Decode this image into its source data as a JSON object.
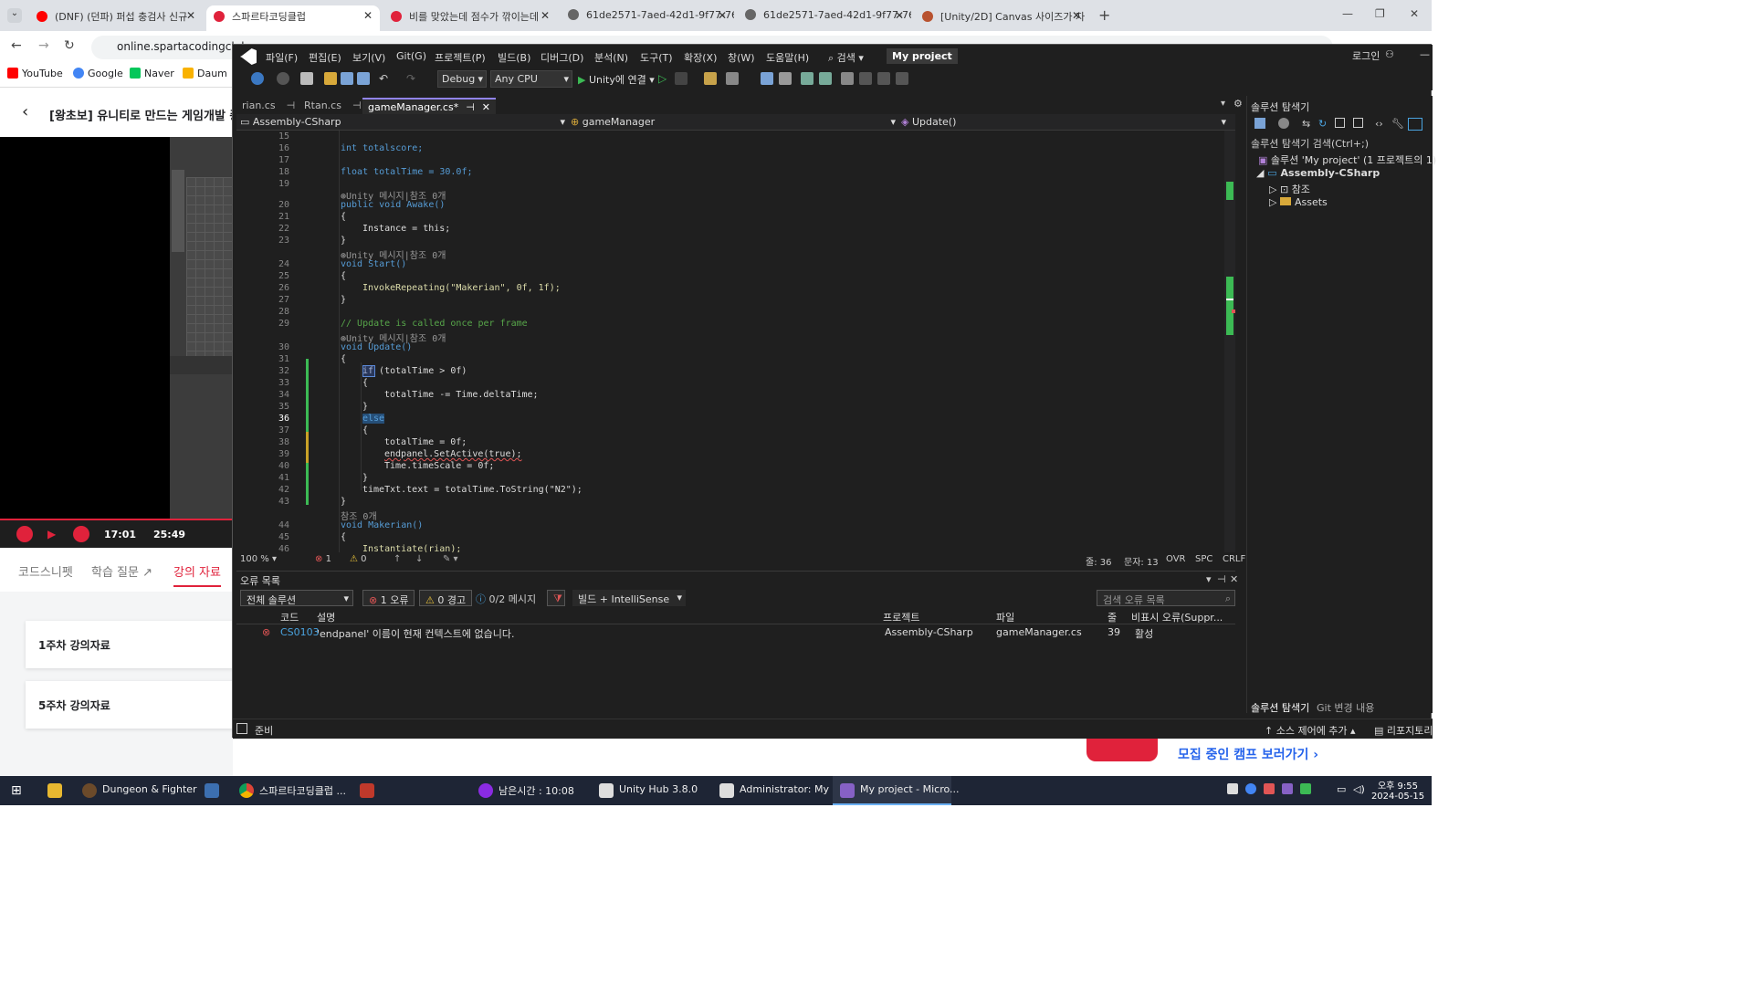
{
  "browser": {
    "tabs": [
      {
        "label": "(DNF) (던파) 퍼섭 충검사 신규",
        "color": "#ff0000"
      },
      {
        "label": "스파르타코딩클럽",
        "color": "#e0223b"
      },
      {
        "label": "비를 맞았는데 점수가 깎이는데",
        "color": "#e0223b"
      },
      {
        "label": "61de2571-7aed-42d1-9f77-76",
        "color": "#666666"
      },
      {
        "label": "61de2571-7aed-42d1-9f77-76",
        "color": "#666666"
      },
      {
        "label": "[Unity/2D] Canvas 사이즈가 자",
        "color": "#b8522f"
      }
    ],
    "url": "online.spartacodingclub.",
    "bookmarks": [
      {
        "label": "YouTube",
        "color": "#ff0000"
      },
      {
        "label": "Google",
        "color": "#4285f4"
      },
      {
        "label": "Naver",
        "color": "#03c75a"
      },
      {
        "label": "Daum",
        "color": "#f9b200"
      }
    ]
  },
  "lecture": {
    "title": "[왕초보] 유니티로 만드는 게임개발 종..",
    "time_current": "17:01",
    "time_total": "25:49",
    "tabs": [
      "코드스니펫",
      "학습 질문",
      "강의 자료"
    ],
    "cards": [
      "1주차 강의자료",
      "5주차 강의자료"
    ],
    "camp_link": "모집 중인 캠프 보러가기"
  },
  "vs": {
    "menu": [
      "파일(F)",
      "편집(E)",
      "보기(V)",
      "Git(G)",
      "프로젝트(P)",
      "빌드(B)",
      "디버그(D)",
      "분석(N)",
      "도구(T)",
      "확장(X)",
      "창(W)",
      "도움말(H)"
    ],
    "search_label": "검색",
    "project_name": "My project",
    "login": "로그인",
    "config": "Debug",
    "platform": "Any CPU",
    "attach": "Unity에 연결",
    "editor_tabs": [
      "rian.cs",
      "Rtan.cs",
      "gameManager.cs*"
    ],
    "nav": {
      "project": "Assembly-CSharp",
      "class": "gameManager",
      "method": "Update()"
    },
    "line_numbers": [
      "15",
      "16",
      "17",
      "18",
      "19",
      "20",
      "21",
      "22",
      "23",
      "24",
      "25",
      "26",
      "27",
      "28",
      "29",
      "30",
      "31",
      "32",
      "33",
      "34",
      "35",
      "36",
      "37",
      "38",
      "39",
      "40",
      "41",
      "42",
      "43",
      "44",
      "45",
      "46"
    ],
    "code": {
      "l16": "int totalscore;",
      "l18": "float totalTime = 30.0f;",
      "lens1": "Unity 메시지|참조 0개",
      "l20": "public void Awake()",
      "l21": "{",
      "l22": "Instance = this;",
      "l23": "}",
      "lens2": "Unity 메시지|참조 0개",
      "l24": "void Start()",
      "l25": "{",
      "l26": "InvokeRepeating(\"Makerian\", 0f, 1f);",
      "l27": "}",
      "l29": "// Update is called once per frame",
      "lens3": "Unity 메시지|참조 0개",
      "l30": "void Update()",
      "l31": "{",
      "l32": "if (totalTime > 0f)",
      "l33": "{",
      "l34": "totalTime -= Time.deltaTime;",
      "l35": "}",
      "l36": "else",
      "l37": "{",
      "l38": "totalTime = 0f;",
      "l39": "endpanel.SetActive(true);",
      "l40": "Time.timeScale = 0f;",
      "l41": "}",
      "l42": "timeTxt.text = totalTime.ToString(\"N2\");",
      "l43": "}",
      "lens4": "참조 0개",
      "l44": "void Makerian()",
      "l45": "{",
      "l46": "Instantiate(rian);"
    },
    "status": {
      "zoom": "100 %",
      "errors": "1",
      "warnings": "0",
      "line": "줄: 36",
      "col": "문자: 13",
      "ovr": "OVR",
      "spc": "SPC",
      "crlf": "CRLF"
    },
    "errors": {
      "title": "오류 목록",
      "scope": "전체 솔루션",
      "err_btn": "1 오류",
      "warn_btn": "0 경고",
      "msg_btn": "0/2 메시지",
      "filter": "빌드 + IntelliSense",
      "search": "검색 오류 목록",
      "columns": [
        "코드",
        "설명",
        "프로젝트",
        "파일",
        "줄",
        "비표시 오류(Suppr..."
      ],
      "rows": [
        {
          "code": "CS0103",
          "desc": "'endpanel' 이름이 현재 컨텍스트에 없습니다.",
          "project": "Assembly-CSharp",
          "file": "gameManager.cs",
          "line": "39",
          "state": "활성"
        }
      ]
    },
    "solution": {
      "title": "솔루션 탐색기",
      "search": "솔루션 탐색기 검색(Ctrl+;)",
      "items": [
        "솔루션 'My project' (1 프로젝트의 1)",
        "Assembly-CSharp",
        "참조",
        "Assets"
      ],
      "bottom_tabs": [
        "솔루션 탐색기",
        "Git 변경 내용"
      ]
    },
    "bottom": {
      "ready": "준비",
      "source": "소스 제어에 추가",
      "repo": "리포지토리"
    }
  },
  "taskbar": {
    "items": [
      "Dungeon & Fighter",
      "스파르타코딩클럽 ...",
      "남은시간 : 10:08",
      "Unity Hub 3.8.0",
      "Administrator: My ...",
      "My project - Micro..."
    ],
    "time": "오후 9:55",
    "date": "2024-05-15"
  }
}
